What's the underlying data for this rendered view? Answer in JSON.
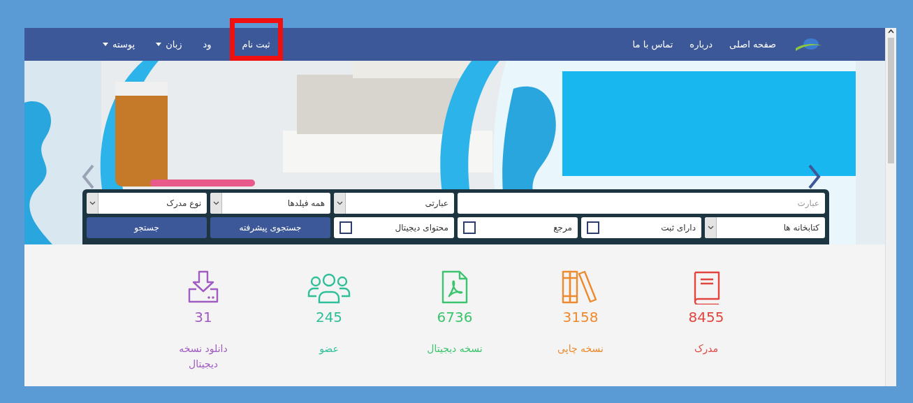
{
  "navbar": {
    "menu": [
      {
        "label": "صفحه اصلی"
      },
      {
        "label": "درباره"
      },
      {
        "label": "تماس با ما"
      }
    ],
    "user_menu": [
      {
        "label": "ثبت نام",
        "dropdown": false,
        "highlighted": true
      },
      {
        "label": "ود",
        "dropdown": false,
        "highlighted": false
      },
      {
        "label": "زبان",
        "dropdown": true,
        "highlighted": false
      },
      {
        "label": "پوسته",
        "dropdown": true,
        "highlighted": false
      }
    ]
  },
  "search": {
    "query": {
      "placeholder": "عبارت"
    },
    "selects": [
      {
        "value": "عبارتی"
      },
      {
        "value": "همه فیلدها"
      },
      {
        "value": "نوع مدرک"
      }
    ],
    "libraries": {
      "value": "کتابخانه ها"
    },
    "checkboxes": [
      {
        "label": "دارای ثبت",
        "checked": false
      },
      {
        "label": "مرجع",
        "checked": false
      },
      {
        "label": "محتوای دیجیتال",
        "checked": false
      }
    ],
    "buttons": [
      {
        "label": "جستجوی پیشرفته"
      },
      {
        "label": "جستجو"
      }
    ]
  },
  "stats": [
    {
      "kind": "book",
      "count": "8455",
      "label": "مدرک",
      "color": "#e2453f"
    },
    {
      "kind": "books",
      "count": "3158",
      "label": "نسخه چاپی",
      "color": "#ee8a2e"
    },
    {
      "kind": "pdf",
      "count": "6736",
      "label": "نسخه دیجیتال",
      "color": "#3cc46e"
    },
    {
      "kind": "users",
      "count": "245",
      "label": "عضو",
      "color": "#2fbf98"
    },
    {
      "kind": "download",
      "count": "31",
      "label": "دانلود نسخه دیجیتال",
      "color": "#a05cc0"
    }
  ]
}
